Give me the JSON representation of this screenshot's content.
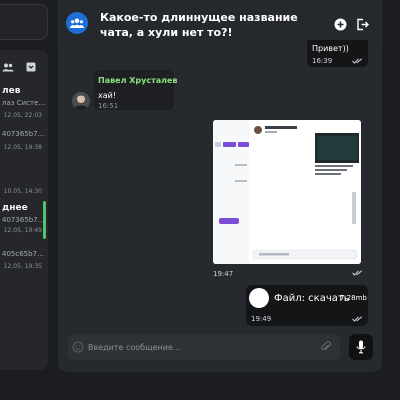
{
  "chat_list": {
    "items": [
      {
        "title": "лев",
        "preview": "лаз Систе…",
        "time": "12.05, 22:03"
      },
      {
        "title": "",
        "preview": "407365b7…",
        "time": "12.05, 19:38"
      },
      {
        "title": "",
        "preview": "",
        "time": "10.05, 14:30"
      },
      {
        "title": "днее",
        "preview": "407365b7…",
        "time": "12.05, 19:49"
      },
      {
        "title": "",
        "preview": "405c65b7…",
        "time": "12.05, 19:35"
      }
    ]
  },
  "chat": {
    "title": "Какое-то длиннущее название чата, а хули нет то?!"
  },
  "messages": {
    "m1": {
      "text": "Привет))",
      "time": "16:39"
    },
    "m2": {
      "sender": "Павел Хрусталев",
      "text": "хай!",
      "time": "16:51"
    },
    "m3": {
      "time": "19:47"
    },
    "m4": {
      "file_label": "Файл: скачать",
      "size": "7.28mb",
      "time": "19:49"
    }
  },
  "composer": {
    "placeholder": "Введите сообщение..."
  },
  "colors": {
    "accent_green": "#53c46a",
    "sender_name": "#8be37d",
    "chat_avatar": "#1d6fd6"
  },
  "icons": {
    "chat_avatar": "users-icon",
    "add": "plus-circle-icon",
    "leave": "logout-icon",
    "read": "double-check-icon",
    "emoji": "emoji-icon",
    "attach": "paperclip-icon",
    "mic": "microphone-icon",
    "new_group": "group-add-icon",
    "new_chat": "chat-add-icon"
  }
}
